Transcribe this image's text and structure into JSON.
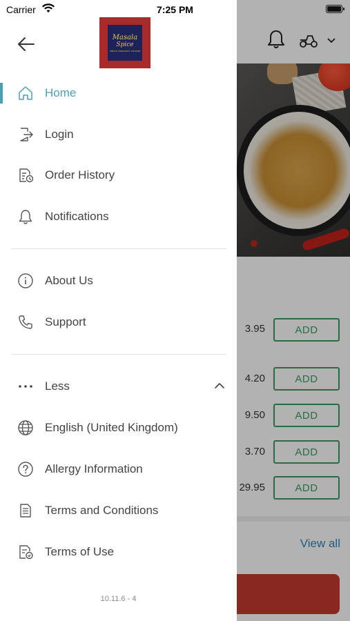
{
  "status_bar": {
    "carrier": "Carrier",
    "time": "7:25 PM"
  },
  "logo": {
    "line1": "Masala",
    "line2": "Spice",
    "tagline": "INDIAN TAKEAWAY CUISINE"
  },
  "menu": {
    "primary": [
      {
        "label": "Home",
        "icon": "home-icon",
        "active": true
      },
      {
        "label": "Login",
        "icon": "login-icon"
      },
      {
        "label": "Order History",
        "icon": "order-history-icon"
      },
      {
        "label": "Notifications",
        "icon": "bell-icon"
      }
    ],
    "secondary": [
      {
        "label": "About Us",
        "icon": "info-icon"
      },
      {
        "label": "Support",
        "icon": "phone-icon"
      }
    ],
    "more_toggle": {
      "label": "Less",
      "icon": "more-dots-icon"
    },
    "extra": [
      {
        "label": "English (United Kingdom)",
        "icon": "globe-icon"
      },
      {
        "label": "Allergy Information",
        "icon": "help-circle-icon"
      },
      {
        "label": "Terms and Conditions",
        "icon": "document-icon"
      },
      {
        "label": "Terms of Use",
        "icon": "document-check-icon"
      }
    ]
  },
  "version": "10.11.6 - 4",
  "background": {
    "products": [
      {
        "price": "3.95",
        "button": "ADD"
      },
      {
        "price": "4.20",
        "button": "ADD"
      },
      {
        "price": "9.50",
        "button": "ADD"
      },
      {
        "price": "3.70",
        "button": "ADD"
      },
      {
        "price": "29.95",
        "button": "ADD"
      }
    ],
    "view_all": "View all"
  },
  "colors": {
    "accent": "#4d9fb5",
    "add_green": "#3d9a63",
    "brand_red": "#a72b2a",
    "brand_navy": "#1d2358",
    "link_blue": "#2a88b8"
  }
}
